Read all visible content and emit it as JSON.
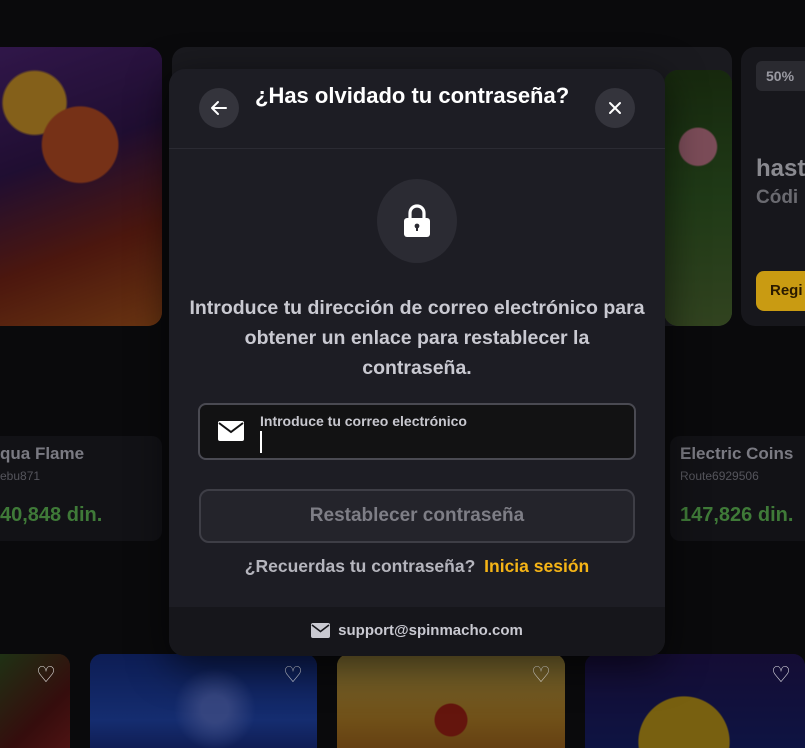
{
  "modal": {
    "title": "¿Has olvidado tu contraseña?",
    "description": "Introduce tu dirección de correo electrónico para obtener un enlace para restablecer la contraseña.",
    "email_label": "Introduce tu correo electrónico",
    "email_value": "",
    "reset_button": "Restablecer contraseña",
    "remember_text": "¿Recuerdas tu contraseña?",
    "login_link": "Inicia sesión",
    "support_email": "support@spinmacho.com",
    "icons": {
      "back": "arrow-left-icon",
      "close": "close-icon",
      "lock": "lock-icon",
      "mail": "mail-icon"
    },
    "colors": {
      "accent": "#f5b416",
      "modal_bg": "#1d1d24",
      "footer_bg": "#16161b"
    }
  },
  "background": {
    "promo": {
      "badge": "50%",
      "title": "hast",
      "subtitle": "Códi",
      "button": "Regi"
    },
    "games": [
      {
        "name": "qua Flame",
        "user": "ebu871",
        "amount": "40,848 din."
      },
      {
        "name": "Electric Coins",
        "user": "Route6929506",
        "amount": "147,826 din."
      }
    ],
    "amount_color": "#3f7a38"
  }
}
